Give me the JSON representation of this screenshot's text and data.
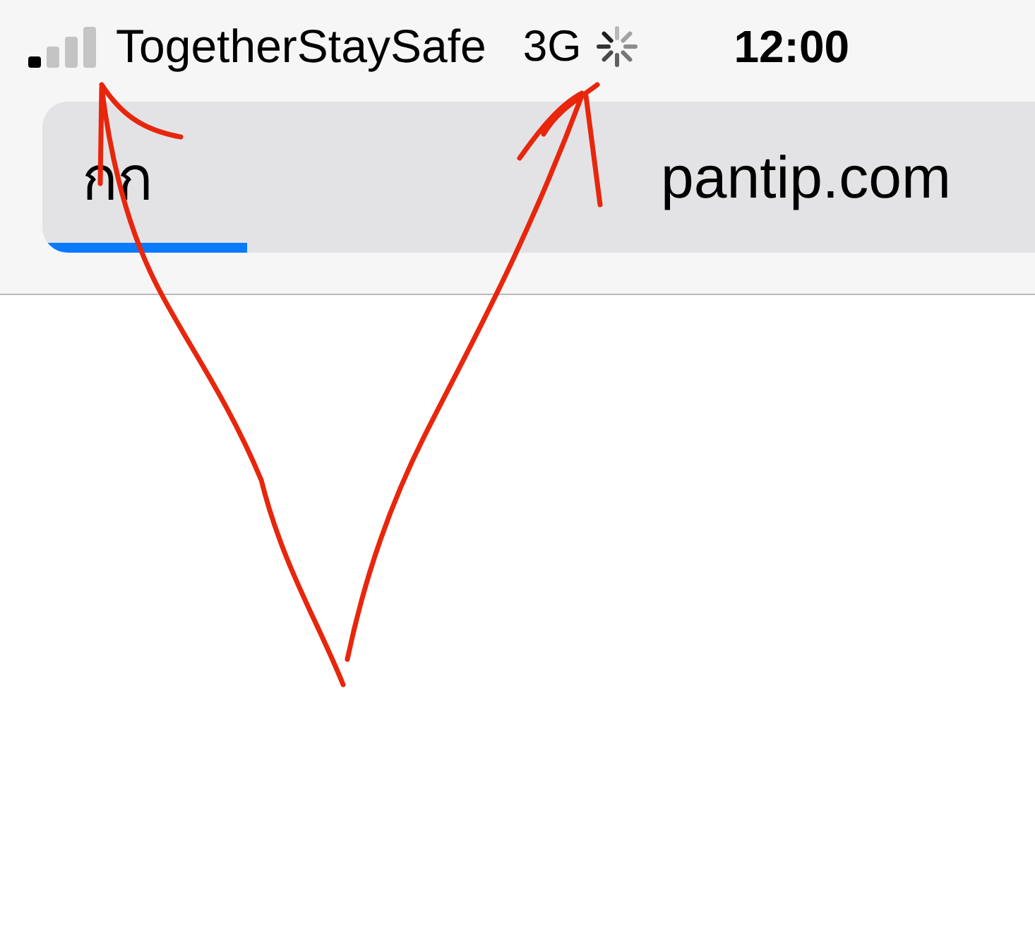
{
  "status_bar": {
    "carrier": "TogetherStaySafe",
    "network": "3G",
    "loading": true,
    "time": "12:00"
  },
  "address_bar": {
    "query": "กก",
    "url": "pantip.com",
    "progress": {
      "level": 0.19
    }
  }
}
